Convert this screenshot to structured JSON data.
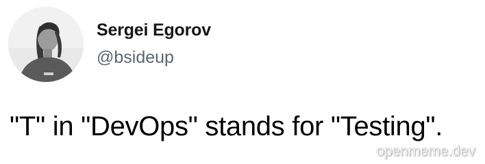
{
  "author": {
    "display_name": "Sergei Egorov",
    "handle": "@bsideup"
  },
  "tweet": {
    "text": "\"T\" in \"DevOps\" stands for \"Testing\"."
  },
  "watermark": {
    "text": "openmeme.dev"
  },
  "colors": {
    "background": "#ffffff",
    "name": "#14171a",
    "handle": "#5b6670",
    "text": "#000000"
  },
  "icons": {
    "avatar": "user-avatar-photo"
  }
}
